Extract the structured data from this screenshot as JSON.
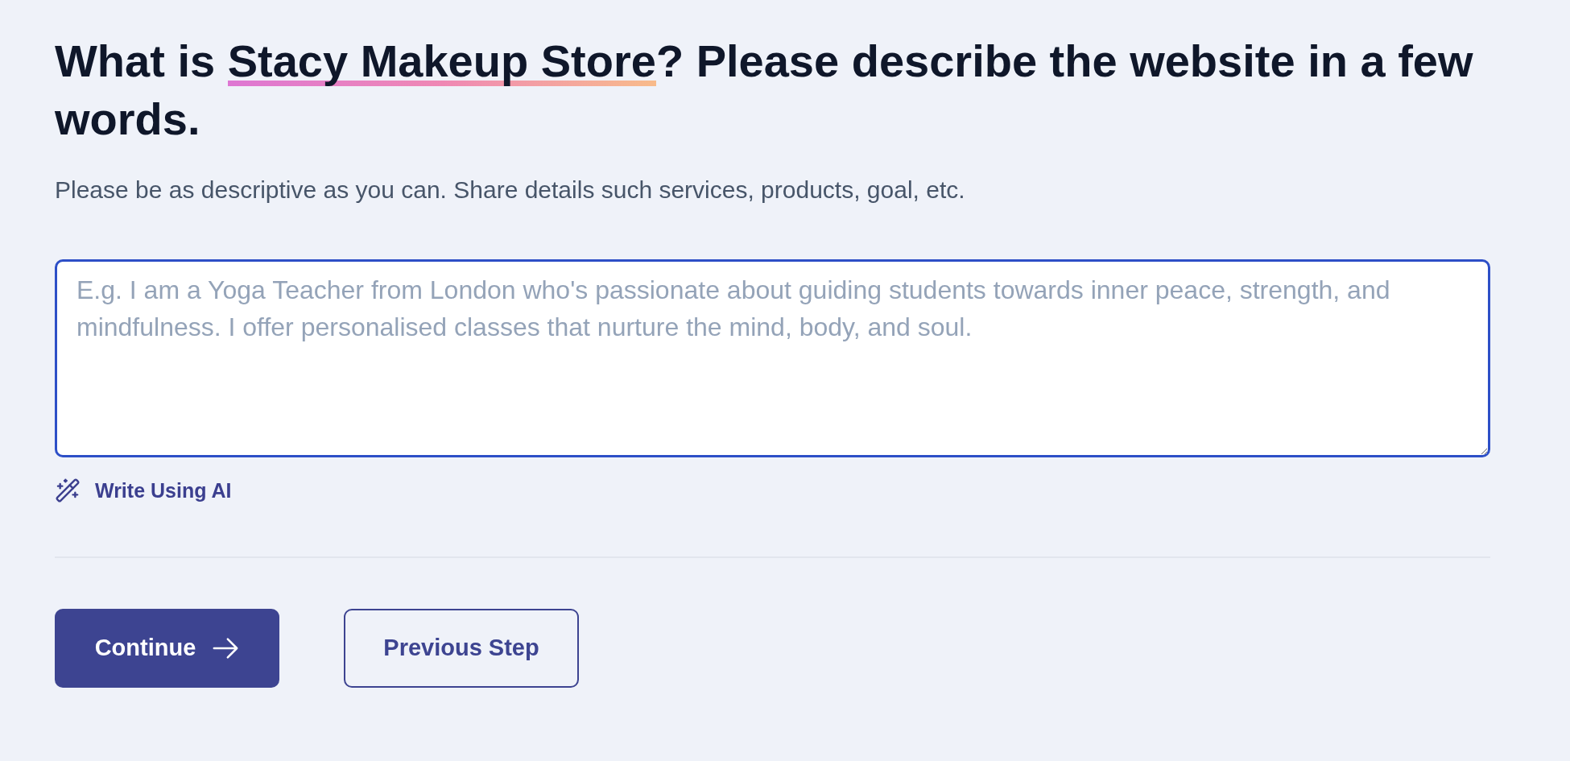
{
  "question": {
    "parts": [
      {
        "text": "What is ",
        "highlighted": false
      },
      {
        "text": "Stacy Makeup Store",
        "highlighted": true
      },
      {
        "text": "? Please describe the website in a few words.",
        "highlighted": false
      }
    ]
  },
  "hint": "Please be as descriptive as you can. Share details such services, products, goal, etc.",
  "description_field": {
    "placeholder": "E.g. I am a Yoga Teacher from London who's passionate about guiding students towards inner peace, strength, and mindfulness. I offer personalised classes that nurture the mind, body, and soul.",
    "focused": true
  },
  "ai_write_link": {
    "label": "Write Using AI"
  },
  "buttons": [
    {
      "kind": "primary",
      "label": "Continue"
    },
    {
      "kind": "secondary",
      "label": "Previous Step"
    }
  ]
}
